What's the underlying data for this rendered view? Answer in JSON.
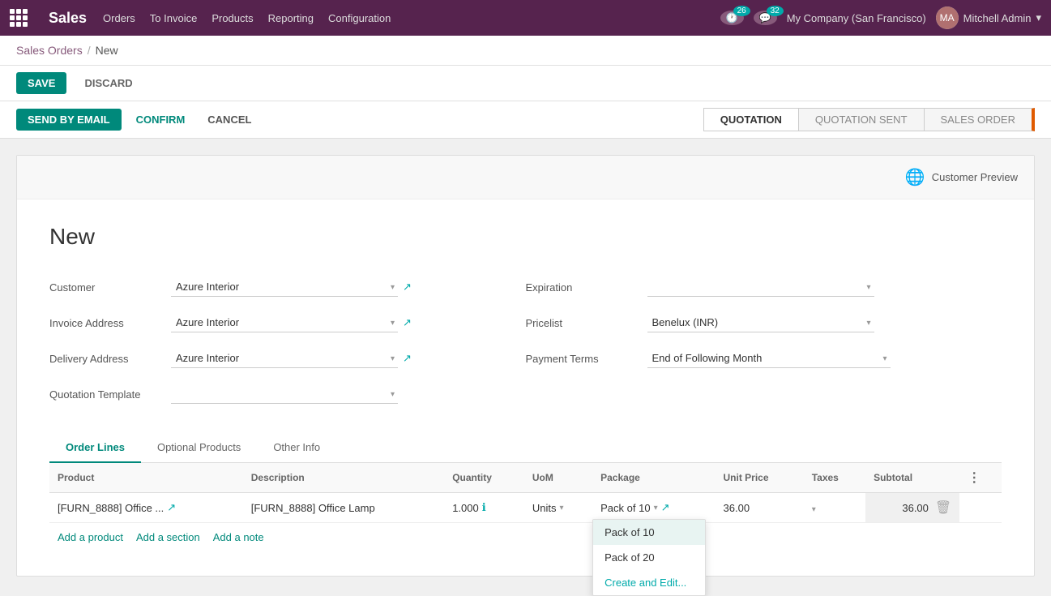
{
  "app": {
    "brand": "Sales",
    "nav_items": [
      "Orders",
      "To Invoice",
      "Products",
      "Reporting",
      "Configuration"
    ],
    "notification_count": "26",
    "message_count": "32",
    "company": "My Company (San Francisco)",
    "user": "Mitchell Admin"
  },
  "breadcrumb": {
    "parent": "Sales Orders",
    "current": "New"
  },
  "actions": {
    "save": "SAVE",
    "discard": "DISCARD",
    "send_email": "SEND BY EMAIL",
    "confirm": "CONFIRM",
    "cancel": "CANCEL"
  },
  "status_steps": [
    "QUOTATION",
    "QUOTATION SENT",
    "SALES ORDER"
  ],
  "form": {
    "title": "New",
    "customer_label": "Customer",
    "customer_value": "Azure Interior",
    "invoice_address_label": "Invoice Address",
    "invoice_address_value": "Azure Interior",
    "delivery_address_label": "Delivery Address",
    "delivery_address_value": "Azure Interior",
    "quotation_template_label": "Quotation Template",
    "expiration_label": "Expiration",
    "pricelist_label": "Pricelist",
    "pricelist_value": "Benelux (INR)",
    "payment_terms_label": "Payment Terms",
    "payment_terms_value": "End of Following Month",
    "customer_preview": "Customer Preview"
  },
  "tabs": [
    {
      "label": "Order Lines",
      "active": true
    },
    {
      "label": "Optional Products",
      "active": false
    },
    {
      "label": "Other Info",
      "active": false
    }
  ],
  "table": {
    "columns": [
      "Product",
      "Description",
      "Quantity",
      "UoM",
      "Package",
      "Unit Price",
      "Taxes",
      "Subtotal",
      ""
    ],
    "rows": [
      {
        "product": "[FURN_8888] Office ...",
        "description": "[FURN_8888] Office Lamp",
        "quantity": "1.000",
        "uom": "Units",
        "package": "Pack of 10",
        "unit_price": "36.00",
        "taxes": "",
        "subtotal": "36.00"
      }
    ],
    "add_product": "Add a product",
    "add_section": "Add a section",
    "add_note": "Add a note"
  },
  "package_dropdown": {
    "options": [
      "Pack of 10",
      "Pack of 20",
      "Create and Edit..."
    ],
    "selected": "Pack of 10"
  }
}
